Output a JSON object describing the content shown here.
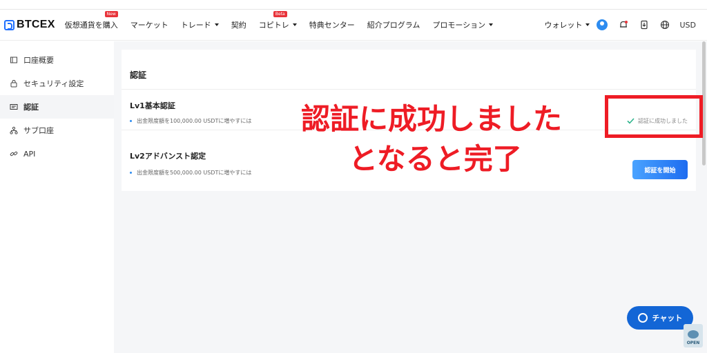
{
  "logo": {
    "text": "BTCEX"
  },
  "nav": {
    "items": [
      {
        "label": "仮想通貨を購入",
        "badge": "New",
        "caret": false
      },
      {
        "label": "マーケット",
        "badge": "",
        "caret": false
      },
      {
        "label": "トレード",
        "badge": "",
        "caret": true
      },
      {
        "label": "契約",
        "badge": "",
        "caret": false
      },
      {
        "label": "コピトレ",
        "badge": "Beta",
        "caret": true
      },
      {
        "label": "特典センター",
        "badge": "",
        "caret": false
      },
      {
        "label": "紹介プログラム",
        "badge": "",
        "caret": false
      },
      {
        "label": "プロモーション",
        "badge": "",
        "caret": true
      }
    ],
    "wallet_label": "ウォレット",
    "currency": "USD"
  },
  "sidebar": {
    "items": [
      {
        "label": "口座概要",
        "icon": "account-icon"
      },
      {
        "label": "セキュリティ設定",
        "icon": "lock-icon"
      },
      {
        "label": "認証",
        "icon": "id-card-icon"
      },
      {
        "label": "サブ口座",
        "icon": "sub-account-icon"
      },
      {
        "label": "API",
        "icon": "link-icon"
      }
    ],
    "active_index": 2
  },
  "main": {
    "title": "認証",
    "levels": [
      {
        "title": "Lv1基本認証",
        "desc": "出金限度額を100,000.00 USDTに増やすには",
        "status": "認証に成功しました"
      },
      {
        "title": "Lv2アドバンスト認定",
        "desc": "出金限度額を500,000.00 USDTに増やすには",
        "action": "認証を開始"
      }
    ]
  },
  "annotation": {
    "line1": "認証に成功しました",
    "line2": "となると完了",
    "color": "#ee1c25"
  },
  "chat": {
    "label": "チャット"
  },
  "open_widget": {
    "label": "OPEN"
  },
  "colors": {
    "accent": "#1e6fff",
    "badge": "#e8333a",
    "success": "#2bb38a"
  }
}
